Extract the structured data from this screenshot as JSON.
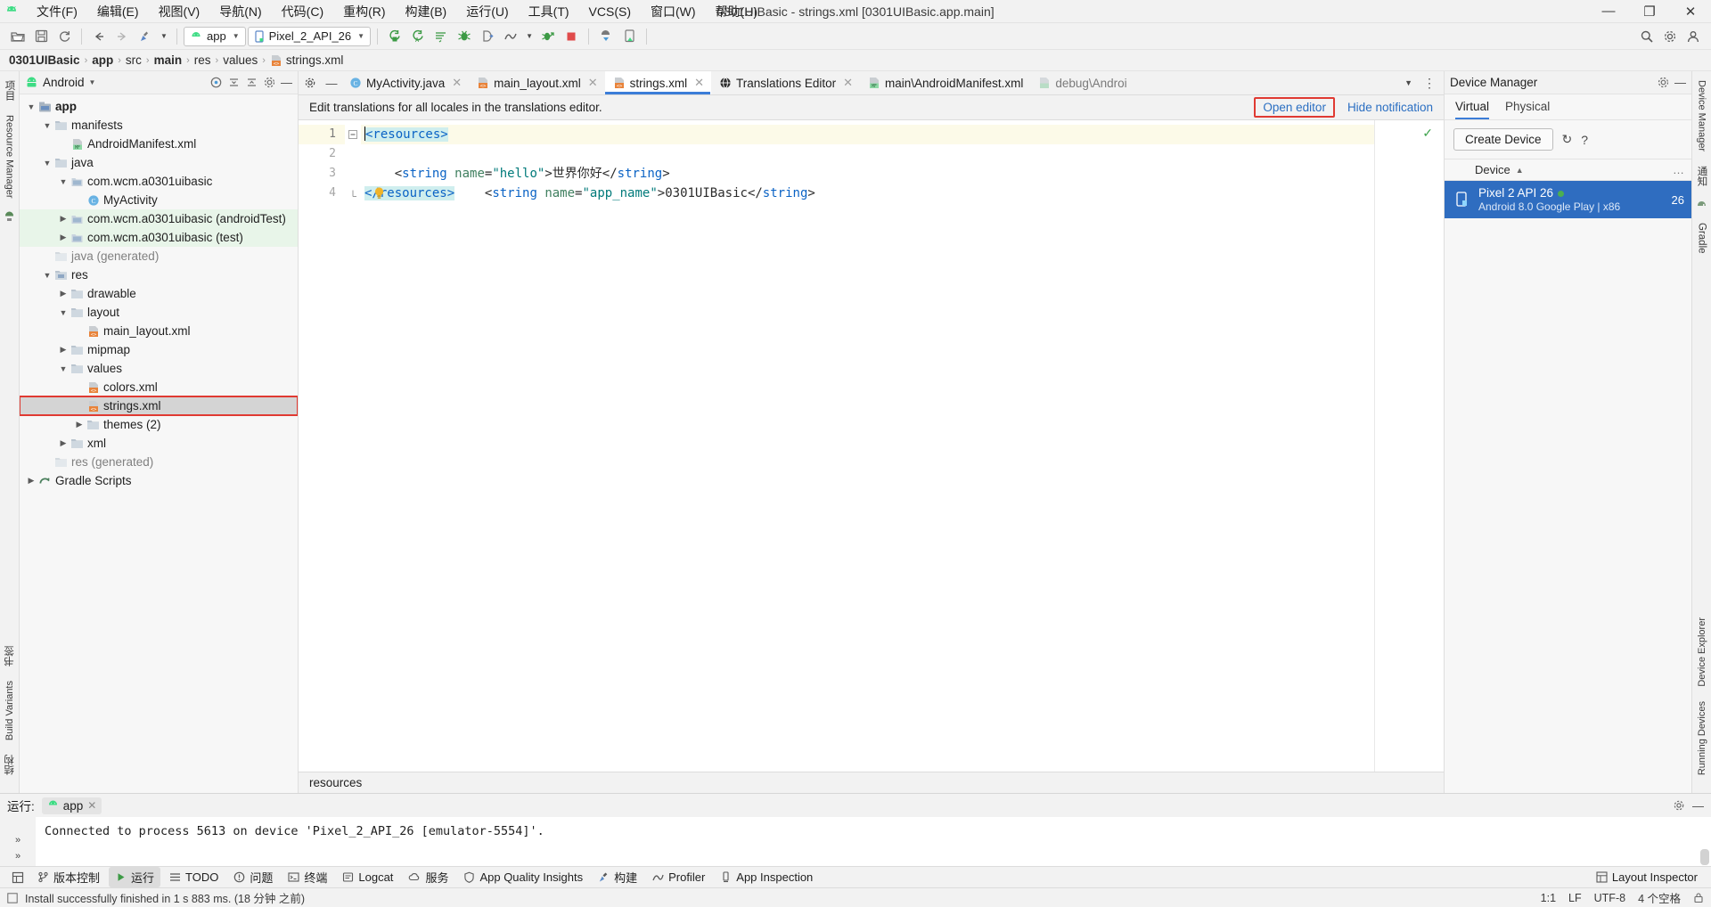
{
  "window": {
    "title": "0301UIBasic - strings.xml [0301UIBasic.app.main]",
    "minimize": "—",
    "maximize": "❐",
    "close": "✕"
  },
  "menu": {
    "items": [
      {
        "label": "文件(F)",
        "name": "menu-file"
      },
      {
        "label": "编辑(E)",
        "name": "menu-edit"
      },
      {
        "label": "视图(V)",
        "name": "menu-view"
      },
      {
        "label": "导航(N)",
        "name": "menu-navigate"
      },
      {
        "label": "代码(C)",
        "name": "menu-code"
      },
      {
        "label": "重构(R)",
        "name": "menu-refactor"
      },
      {
        "label": "构建(B)",
        "name": "menu-build"
      },
      {
        "label": "运行(U)",
        "name": "menu-run"
      },
      {
        "label": "工具(T)",
        "name": "menu-tools"
      },
      {
        "label": "VCS(S)",
        "name": "menu-vcs"
      },
      {
        "label": "窗口(W)",
        "name": "menu-window"
      },
      {
        "label": "帮助(H)",
        "name": "menu-help"
      }
    ]
  },
  "toolbar": {
    "module_config": "app",
    "device_config": "Pixel_2_API_26",
    "caret": "▼"
  },
  "breadcrumb": {
    "items": [
      "0301UIBasic",
      "app",
      "src",
      "main",
      "res",
      "values",
      "strings.xml"
    ],
    "separator": "›"
  },
  "project": {
    "view_name": "Android",
    "caret": "▼",
    "tree": [
      {
        "label": "app",
        "depth": 0,
        "arrow": "open",
        "icon": "module",
        "bold": true
      },
      {
        "label": "manifests",
        "depth": 1,
        "arrow": "open",
        "icon": "folder"
      },
      {
        "label": "AndroidManifest.xml",
        "depth": 2,
        "arrow": "none",
        "icon": "manifest"
      },
      {
        "label": "java",
        "depth": 1,
        "arrow": "open",
        "icon": "folder"
      },
      {
        "label": "com.wcm.a0301uibasic",
        "depth": 2,
        "arrow": "open",
        "icon": "package"
      },
      {
        "label": "MyActivity",
        "depth": 3,
        "arrow": "none",
        "icon": "class"
      },
      {
        "label": "com.wcm.a0301uibasic (androidTest)",
        "depth": 2,
        "arrow": "closed",
        "icon": "package",
        "green": true
      },
      {
        "label": "com.wcm.a0301uibasic (test)",
        "depth": 2,
        "arrow": "closed",
        "icon": "package",
        "green": true
      },
      {
        "label": "java (generated)",
        "depth": 1,
        "arrow": "none",
        "icon": "folder-gen"
      },
      {
        "label": "res",
        "depth": 1,
        "arrow": "open",
        "icon": "folder-res"
      },
      {
        "label": "drawable",
        "depth": 2,
        "arrow": "closed",
        "icon": "folder"
      },
      {
        "label": "layout",
        "depth": 2,
        "arrow": "open",
        "icon": "folder"
      },
      {
        "label": "main_layout.xml",
        "depth": 3,
        "arrow": "none",
        "icon": "xml"
      },
      {
        "label": "mipmap",
        "depth": 2,
        "arrow": "closed",
        "icon": "folder"
      },
      {
        "label": "values",
        "depth": 2,
        "arrow": "open",
        "icon": "folder"
      },
      {
        "label": "colors.xml",
        "depth": 3,
        "arrow": "none",
        "icon": "xml"
      },
      {
        "label": "strings.xml",
        "depth": 3,
        "arrow": "none",
        "icon": "xml",
        "selected": true,
        "highlight_box": true
      },
      {
        "label": "themes (2)",
        "depth": 3,
        "arrow": "closed",
        "icon": "folder"
      },
      {
        "label": "xml",
        "depth": 2,
        "arrow": "closed",
        "icon": "folder"
      },
      {
        "label": "res (generated)",
        "depth": 1,
        "arrow": "none",
        "icon": "folder-gen"
      },
      {
        "label": "Gradle Scripts",
        "depth": 0,
        "arrow": "closed",
        "icon": "gradle"
      }
    ]
  },
  "editor": {
    "tabs": [
      {
        "label": "MyActivity.java",
        "icon": "java-class-icon",
        "active": false,
        "closable": true
      },
      {
        "label": "main_layout.xml",
        "icon": "xml-file-icon",
        "active": false,
        "closable": true
      },
      {
        "label": "strings.xml",
        "icon": "xml-file-icon",
        "active": true,
        "closable": true
      },
      {
        "label": "Translations Editor",
        "icon": "globe-icon",
        "active": false,
        "closable": true
      },
      {
        "label": "main\\AndroidManifest.xml",
        "icon": "manifest-file-icon",
        "active": false,
        "closable": false
      },
      {
        "label": "debug\\Androi",
        "icon": "manifest-file-icon",
        "active": false,
        "closable": false
      }
    ],
    "tab_overflow": "▼",
    "tab_more": "⋮",
    "notification": {
      "message": "Edit translations for all locales in the translations editor.",
      "open_editor": "Open editor",
      "hide_notification": "Hide notification"
    },
    "lines": [
      {
        "n": "1",
        "current": true
      },
      {
        "n": "2",
        "current": false
      },
      {
        "n": "3",
        "current": false
      },
      {
        "n": "4",
        "current": false
      }
    ],
    "code": {
      "line1_tag": "<resources>",
      "line2_full": "    <string name=\"app_name\">0301UIBasic</string>",
      "line3_full": "    <string name=\"hello\">世界你好</string>",
      "line4_tag": "</resources>"
    },
    "status_ok": "✓",
    "bottom_breadcrumb": "resources"
  },
  "device_manager": {
    "title": "Device Manager",
    "gear": "⚙",
    "minimize": "—",
    "tabs": [
      {
        "label": "Virtual",
        "active": true
      },
      {
        "label": "Physical",
        "active": false
      }
    ],
    "create_device": "Create Device",
    "refresh_icon": "↻",
    "help_icon": "?",
    "column_header": "Device",
    "sort_caret": "▲",
    "more": "…",
    "devices": [
      {
        "name": "Pixel 2 API 26",
        "subtitle": "Android 8.0 Google Play | x86",
        "api": "26",
        "online": true
      }
    ]
  },
  "rails": {
    "left": [
      "项目",
      "Resource Manager"
    ],
    "left_bottom": [
      "书签",
      "Build Variants",
      "结构"
    ],
    "right": [
      "Device Manager",
      "通知",
      "Gradle"
    ],
    "right_bottom": [
      "Device Explorer",
      "Running Devices"
    ]
  },
  "run_window": {
    "title": "运行:",
    "tab_label": "app",
    "tab_close": "✕",
    "gear": "⚙",
    "minimize": "—",
    "console_line": "Connected to process 5613 on device 'Pixel_2_API_26 [emulator-5554]'.",
    "nav_prev": "»",
    "nav_next": "»"
  },
  "bottom_tools": {
    "items": [
      {
        "label": "版本控制",
        "icon": "branch-icon",
        "active": false
      },
      {
        "label": "运行",
        "icon": "play-icon",
        "active": true
      },
      {
        "label": "TODO",
        "icon": "checklist-icon",
        "active": false
      },
      {
        "label": "问题",
        "icon": "warning-icon",
        "active": false
      },
      {
        "label": "终端",
        "icon": "terminal-icon",
        "active": false
      },
      {
        "label": "Logcat",
        "icon": "logcat-icon",
        "active": false
      },
      {
        "label": "服务",
        "icon": "cloud-icon",
        "active": false
      },
      {
        "label": "App Quality Insights",
        "icon": "shield-icon",
        "active": false
      },
      {
        "label": "构建",
        "icon": "hammer-icon",
        "active": false
      },
      {
        "label": "Profiler",
        "icon": "profiler-icon",
        "active": false
      },
      {
        "label": "App Inspection",
        "icon": "inspect-icon",
        "active": false
      }
    ],
    "right": {
      "label": "Layout Inspector",
      "icon": "layout-inspector-icon"
    }
  },
  "status_bar": {
    "message": "Install successfully finished in 1 s 883 ms. (18 分钟 之前)",
    "caret_position": "1:1",
    "line_separator": "LF",
    "encoding": "UTF-8",
    "indent": "4 个空格",
    "lock_icon": "🔒"
  }
}
